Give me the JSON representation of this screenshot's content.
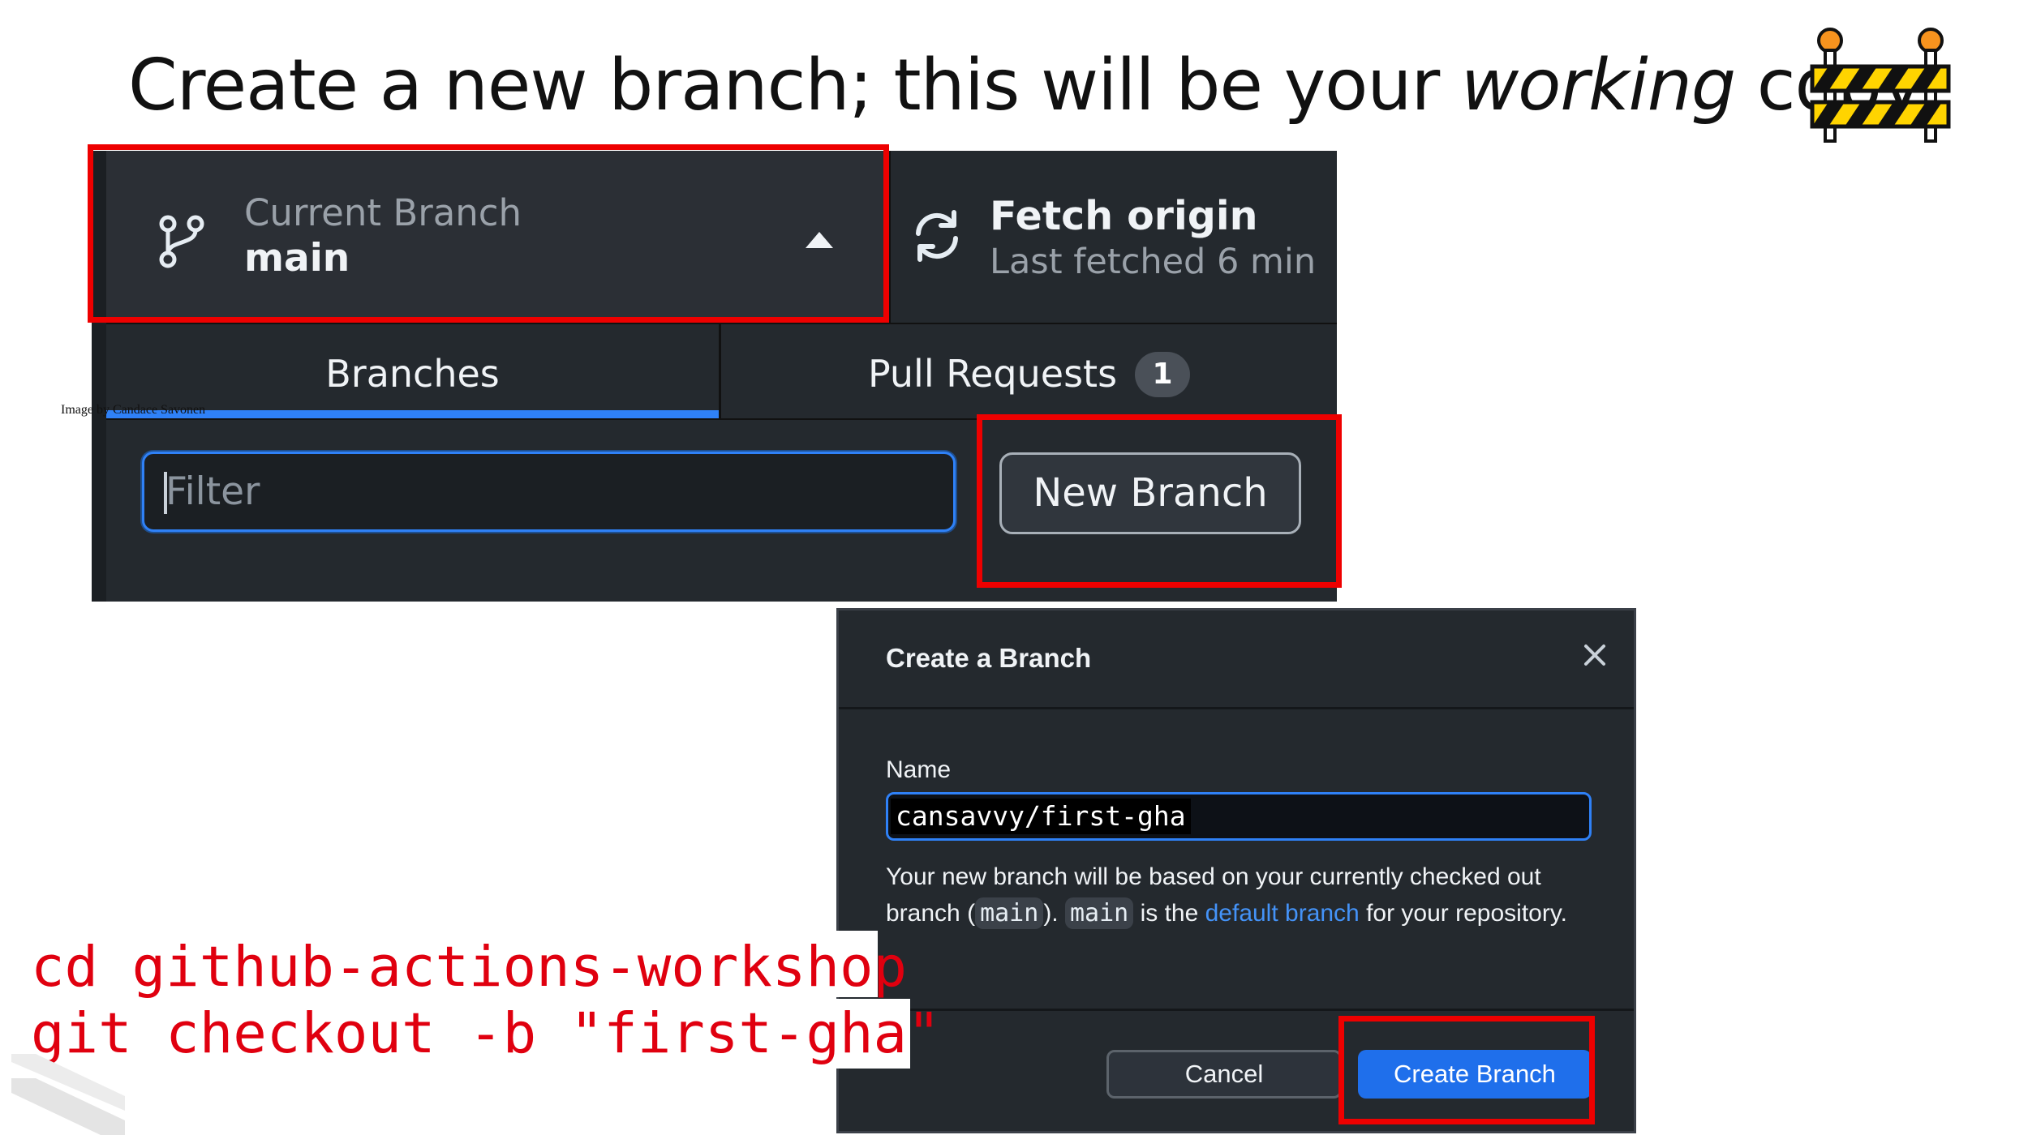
{
  "slide": {
    "title_before": "Create a new branch; this will be your ",
    "title_em": "working",
    "title_after": " copy",
    "credit": "Image by Candace Savonen"
  },
  "toolbar": {
    "current_branch_label": "Current Branch",
    "current_branch_value": "main",
    "fetch_label": "Fetch origin",
    "fetch_sub": "Last fetched 6 min"
  },
  "tabs": {
    "branches": "Branches",
    "pull_requests": "Pull Requests",
    "pr_count": "1"
  },
  "filter": {
    "placeholder": "Filter"
  },
  "new_branch_button": "New Branch",
  "dialog": {
    "title": "Create a Branch",
    "name_label": "Name",
    "name_value": "cansavvy/first-gha",
    "desc_1": "Your new branch will be based on your currently checked out branch (",
    "chip_1": "main",
    "desc_2": "). ",
    "chip_2": "main",
    "desc_3": " is the ",
    "link": "default branch",
    "desc_4": " for your repository.",
    "cancel": "Cancel",
    "create": "Create Branch"
  },
  "cli": {
    "line1": "cd github-actions-workshop",
    "line2": "git checkout -b \"first-gha\""
  },
  "colors": {
    "highlight_red": "#ee0000",
    "cli_red": "#e0000f",
    "panel_bg": "#24292e",
    "accent_blue": "#2f81f7",
    "create_button": "#1f6feb"
  }
}
